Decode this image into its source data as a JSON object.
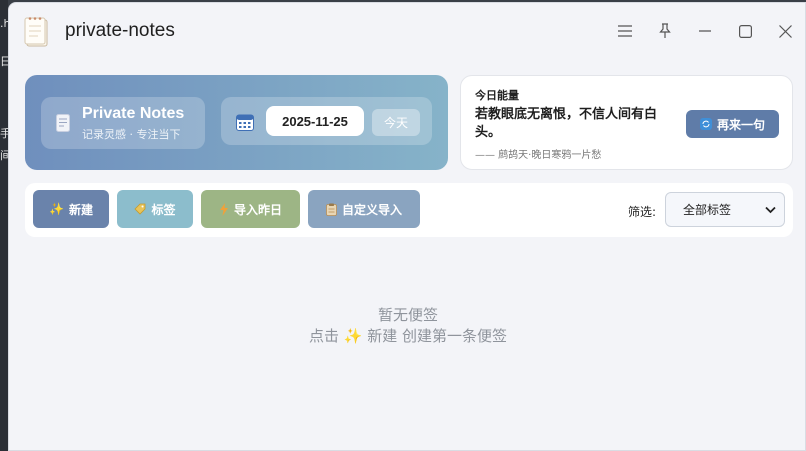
{
  "app": {
    "title": "private-notes"
  },
  "brand": {
    "title": "Private Notes",
    "subtitle": "记录灵感 · 专注当下"
  },
  "date": {
    "value": "2025-11-25",
    "today_label": "今天"
  },
  "quote": {
    "label": "今日能量",
    "text": "若教眼底无离恨，不信人间有白头。",
    "source": "—— 鹧鸪天·晚日寒鸦一片愁",
    "refresh_label": "再来一句"
  },
  "toolbar": {
    "new_label": "新建",
    "tags_label": "标签",
    "import_yesterday_label": "导入昨日",
    "custom_import_label": "自定义导入",
    "filter_label": "筛选:",
    "filter_value": "全部标签"
  },
  "empty": {
    "line1": "暂无便签",
    "line2": "点击 ✨ 新建 创建第一条便签"
  },
  "desktop": {
    "glyphs": [
      ".h",
      "日",
      "手",
      "间"
    ]
  },
  "colors": {
    "accent": "#5f7ca8",
    "hero_start": "#6f8fbd",
    "hero_end": "#86b3c9"
  },
  "icons": {
    "app": "notepad-icon",
    "menu": "hamburger-icon",
    "pin": "pin-icon",
    "minimize": "minimize-icon",
    "maximize": "maximize-icon",
    "close": "close-icon"
  }
}
